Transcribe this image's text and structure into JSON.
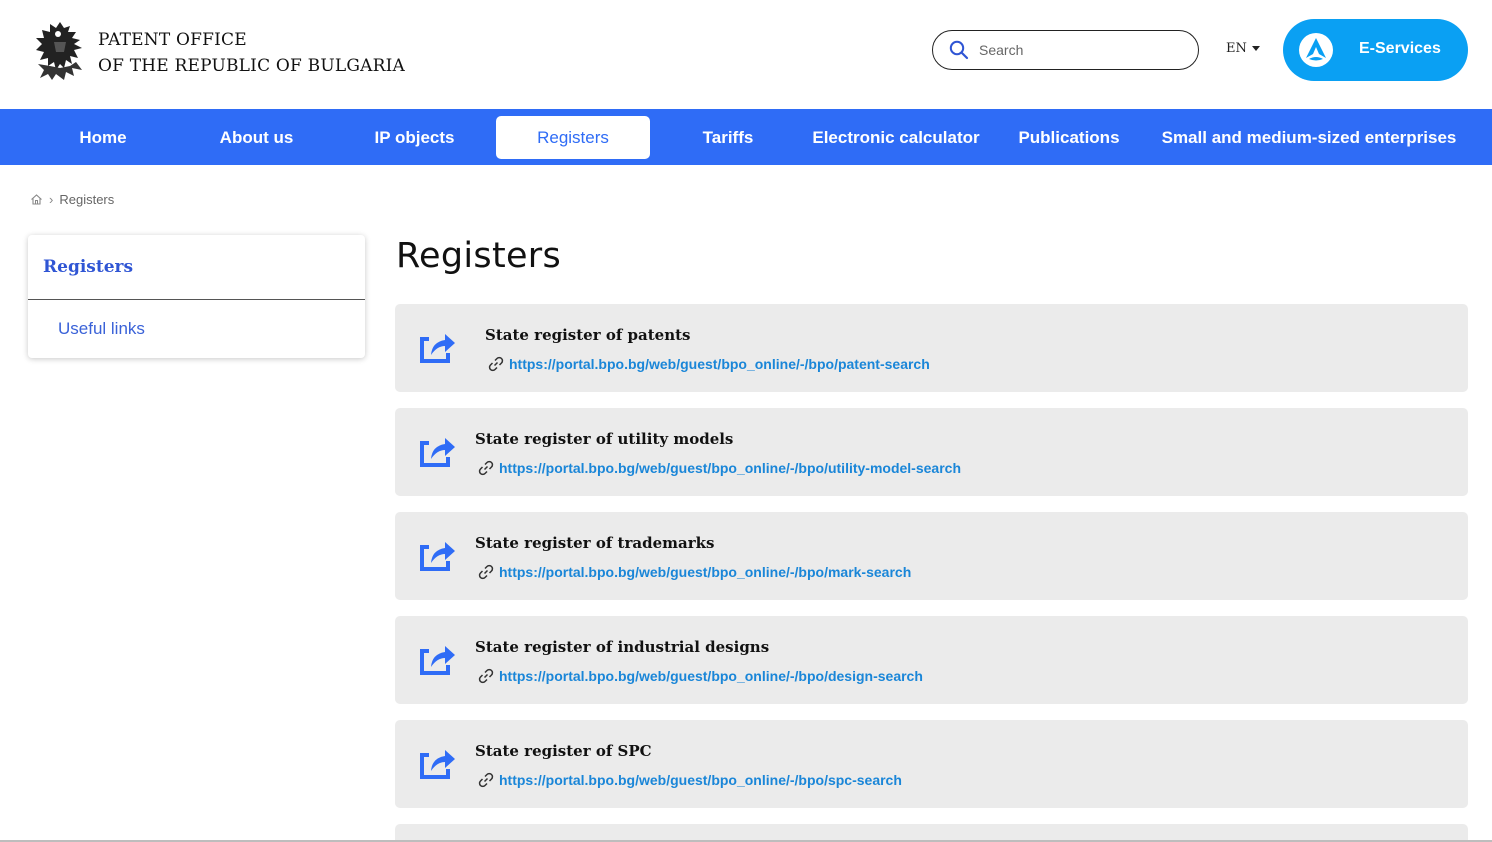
{
  "header": {
    "org_line1": "PATENT OFFICE",
    "org_line2": "OF THE REPUBLIC OF BULGARIA",
    "search_placeholder": "Search",
    "language": "EN",
    "eservices_label": "E-Services"
  },
  "nav": {
    "items": [
      "Home",
      "About us",
      "IP objects",
      "Registers",
      "Tariffs",
      "Electronic calculator",
      "Publications",
      "Small and medium-sized enterprises"
    ],
    "active": "Registers"
  },
  "breadcrumb": {
    "current": "Registers"
  },
  "sidebar": {
    "title": "Registers",
    "links": [
      "Useful links"
    ]
  },
  "main": {
    "title": "Registers",
    "registers": [
      {
        "title": "State register of patents",
        "url": "https://portal.bpo.bg/web/guest/bpo_online/-/bpo/patent-search"
      },
      {
        "title": "State register of utility models",
        "url": "https://portal.bpo.bg/web/guest/bpo_online/-/bpo/utility-model-search"
      },
      {
        "title": "State register of trademarks",
        "url": "https://portal.bpo.bg/web/guest/bpo_online/-/bpo/mark-search"
      },
      {
        "title": "State register of industrial designs",
        "url": "https://portal.bpo.bg/web/guest/bpo_online/-/bpo/design-search"
      },
      {
        "title": "State register of SPC",
        "url": "https://portal.bpo.bg/web/guest/bpo_online/-/bpo/spc-search"
      }
    ]
  },
  "colors": {
    "nav_bg": "#2f6cf6",
    "eservices_bg": "#0aa0f3",
    "link": "#1a86d8",
    "card_bg": "#ebebeb"
  }
}
